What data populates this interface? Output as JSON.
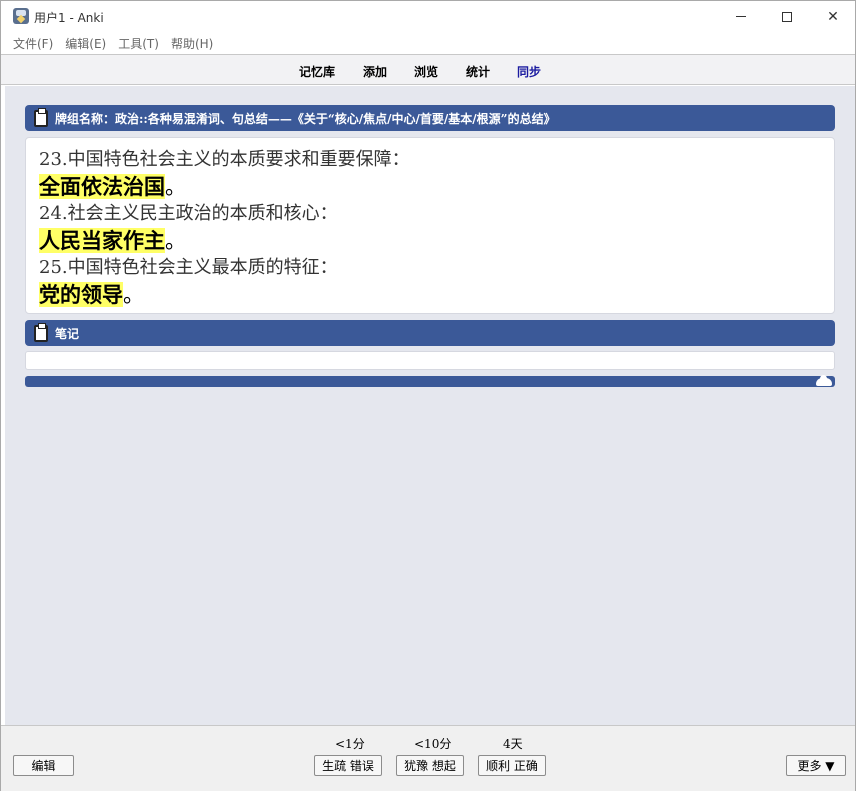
{
  "window": {
    "title": "用户1 - Anki"
  },
  "menu": {
    "items": [
      "文件(F)",
      "编辑(E)",
      "工具(T)",
      "帮助(H)"
    ]
  },
  "toolbar": {
    "decks": "记忆库",
    "add": "添加",
    "browse": "浏览",
    "stats": "统计",
    "sync": "同步"
  },
  "card": {
    "deck_header": "牌组名称：政治::各种易混淆词、句总结——《关于“核心/焦点/中心/首要/基本/根源”的总结》",
    "lines": [
      {
        "q": "23.中国特色社会主义的本质要求和重要保障：",
        "a": "全面依法治国",
        "suffix": "。"
      },
      {
        "q": "24.社会主义民主政治的本质和核心：",
        "a": "人民当家作主",
        "suffix": "。"
      },
      {
        "q": "25.中国特色社会主义最本质的特征：",
        "a": "党的领导",
        "suffix": "。"
      }
    ],
    "notes_header": "笔记",
    "notes_value": ""
  },
  "footer": {
    "edit": "编辑",
    "more": "更多 ▼",
    "answers": [
      {
        "interval": "<1分",
        "label": "生疏 错误"
      },
      {
        "interval": "<10分",
        "label": "犹豫 想起"
      },
      {
        "interval": "4天",
        "label": "顺利 正确"
      }
    ]
  },
  "colors": {
    "header_bg": "#3b5998",
    "highlight": "#ffff66",
    "sync_link": "#1b1ba0"
  }
}
